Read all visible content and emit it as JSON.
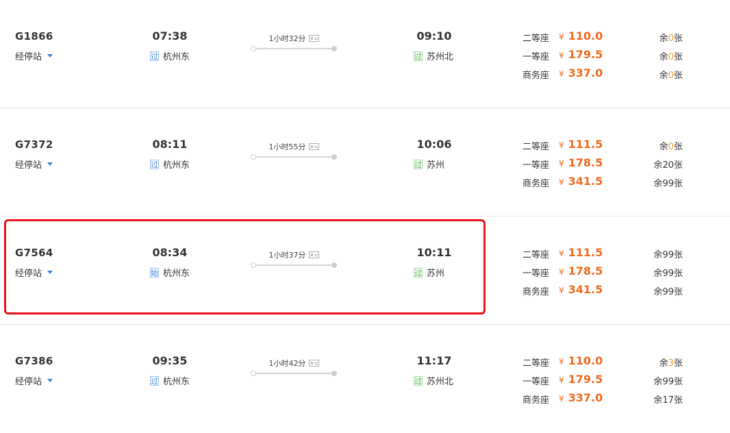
{
  "colors": {
    "price": "#f06a1d",
    "low_stock": "#f2a12e",
    "link": "#3b7fd4",
    "pass_badge": "#3aaa35",
    "highlight": "#e8131a"
  },
  "stops_label": "经停站",
  "trains": [
    {
      "no": "G1866",
      "dep_time": "07:38",
      "dep_badge": "过",
      "dep_station": "杭州东",
      "duration": "1小时32分",
      "arr_time": "09:10",
      "arr_badge": "过",
      "arr_station": "苏州北",
      "seats": [
        {
          "class": "二等座",
          "yen": "¥",
          "price": "110.0",
          "pre": "余",
          "num": "0",
          "suf": "张",
          "low": true
        },
        {
          "class": "一等座",
          "yen": "¥",
          "price": "179.5",
          "pre": "余",
          "num": "0",
          "suf": "张",
          "low": true
        },
        {
          "class": "商务座",
          "yen": "¥",
          "price": "337.0",
          "pre": "余",
          "num": "0",
          "suf": "张",
          "low": true
        }
      ]
    },
    {
      "no": "G7372",
      "dep_time": "08:11",
      "dep_badge": "过",
      "dep_station": "杭州东",
      "duration": "1小时55分",
      "arr_time": "10:06",
      "arr_badge": "过",
      "arr_station": "苏州",
      "seats": [
        {
          "class": "二等座",
          "yen": "¥",
          "price": "111.5",
          "pre": "余",
          "num": "0",
          "suf": "张",
          "low": true
        },
        {
          "class": "一等座",
          "yen": "¥",
          "price": "178.5",
          "pre": "余",
          "num": "20",
          "suf": "张",
          "low": false
        },
        {
          "class": "商务座",
          "yen": "¥",
          "price": "341.5",
          "pre": "余",
          "num": "99",
          "suf": "张",
          "low": false
        }
      ]
    },
    {
      "no": "G7564",
      "dep_time": "08:34",
      "dep_badge": "始",
      "dep_station": "杭州东",
      "duration": "1小时37分",
      "arr_time": "10:11",
      "arr_badge": "过",
      "arr_station": "苏州",
      "seats": [
        {
          "class": "二等座",
          "yen": "¥",
          "price": "111.5",
          "pre": "余",
          "num": "99",
          "suf": "张",
          "low": false
        },
        {
          "class": "一等座",
          "yen": "¥",
          "price": "178.5",
          "pre": "余",
          "num": "99",
          "suf": "张",
          "low": false
        },
        {
          "class": "商务座",
          "yen": "¥",
          "price": "341.5",
          "pre": "余",
          "num": "99",
          "suf": "张",
          "low": false
        }
      ]
    },
    {
      "no": "G7386",
      "dep_time": "09:35",
      "dep_badge": "过",
      "dep_station": "杭州东",
      "duration": "1小时42分",
      "arr_time": "11:17",
      "arr_badge": "过",
      "arr_station": "苏州北",
      "seats": [
        {
          "class": "二等座",
          "yen": "¥",
          "price": "110.0",
          "pre": "余",
          "num": "3",
          "suf": "张",
          "low": true
        },
        {
          "class": "一等座",
          "yen": "¥",
          "price": "179.5",
          "pre": "余",
          "num": "99",
          "suf": "张",
          "low": false
        },
        {
          "class": "商务座",
          "yen": "¥",
          "price": "337.0",
          "pre": "余",
          "num": "17",
          "suf": "张",
          "low": false
        }
      ]
    }
  ]
}
